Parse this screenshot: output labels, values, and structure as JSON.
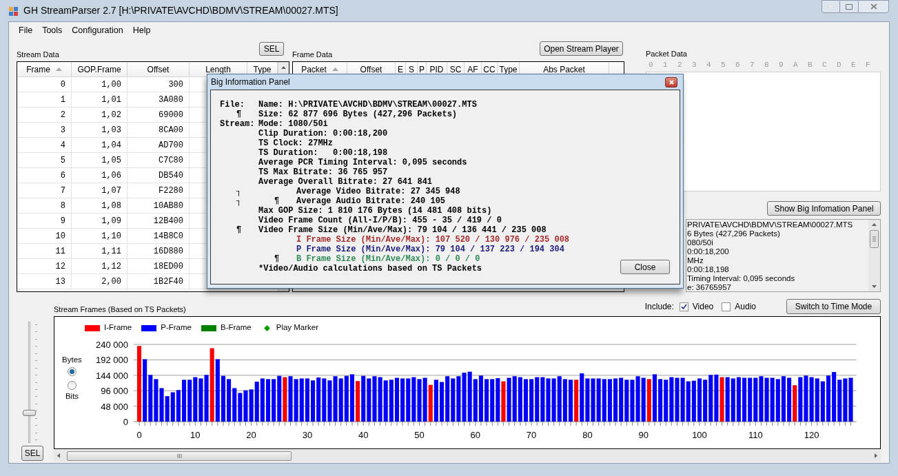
{
  "window": {
    "title": "GH StreamParser 2.7 [H:\\PRIVATE\\AVCHD\\BDMV\\STREAM\\00027.MTS]"
  },
  "menu": [
    "File",
    "Tools",
    "Configuration",
    "Help"
  ],
  "stream_data": {
    "title": "Stream Data",
    "sel_button": "SEL",
    "columns": [
      {
        "label": "Frame",
        "sorted": true
      },
      {
        "label": "GOP.Frame",
        "sorted": false
      },
      {
        "label": "Offset",
        "sorted": false
      },
      {
        "label": "Length",
        "sorted": false
      },
      {
        "label": "Type",
        "sorted": false
      }
    ],
    "rows": [
      [
        "0",
        "1,00",
        "300"
      ],
      [
        "1",
        "1,01",
        "3A080"
      ],
      [
        "2",
        "1,02",
        "69000"
      ],
      [
        "3",
        "1,03",
        "8CA00"
      ],
      [
        "4",
        "1,04",
        "AD700"
      ],
      [
        "5",
        "1,05",
        "C7C80"
      ],
      [
        "6",
        "1,06",
        "DB540"
      ],
      [
        "7",
        "1,07",
        "F2280"
      ],
      [
        "8",
        "1,08",
        "10AB80"
      ],
      [
        "9",
        "1,09",
        "12B400"
      ],
      [
        "10",
        "1,10",
        "14B8C0"
      ],
      [
        "11",
        "1,11",
        "16D880"
      ],
      [
        "12",
        "1,12",
        "18ED00"
      ],
      [
        "13",
        "2,00",
        "1B2F40"
      ]
    ]
  },
  "frame_data": {
    "title": "Frame Data",
    "button": "Open Stream Player",
    "columns": [
      {
        "label": "Packet",
        "sorted": true
      },
      {
        "label": "Offset",
        "sorted": false
      },
      {
        "label": "E",
        "sorted": false
      },
      {
        "label": "S",
        "sorted": false
      },
      {
        "label": "P",
        "sorted": false
      },
      {
        "label": "PID",
        "sorted": false
      },
      {
        "label": "SC",
        "sorted": false
      },
      {
        "label": "AF",
        "sorted": false
      },
      {
        "label": "CC",
        "sorted": false
      },
      {
        "label": "Type",
        "sorted": false
      },
      {
        "label": "Abs Packet",
        "sorted": false
      }
    ]
  },
  "packet_data": {
    "title": "Packet Data",
    "hex_columns": [
      "0",
      "1",
      "2",
      "3",
      "4",
      "5",
      "6",
      "7",
      "8",
      "9",
      "A",
      "B",
      "C",
      "D",
      "E",
      "F"
    ],
    "button": "Show Big Infomation Panel",
    "info_lines": [
      "PRIVATE\\AVCHD\\BDMV\\STREAM\\00027.MTS",
      "6 Bytes (427,296 Packets)",
      "080/50i",
      "0:00:18,200",
      "MHz",
      "0:00:18,198",
      "Timing Interval: 0,095 seconds",
      "e: 36765957"
    ]
  },
  "stream_frames": {
    "title": "Stream Frames (Based on TS Packets)",
    "include_label": "Include:",
    "include": [
      {
        "label": "Video",
        "checked": true
      },
      {
        "label": "Audio",
        "checked": false
      }
    ],
    "button": "Switch to Time Mode",
    "units": [
      {
        "label": "Bytes",
        "selected": true
      },
      {
        "label": "Bits",
        "selected": false
      }
    ],
    "zoom_slider": {
      "level": 0.23
    },
    "sel_button": "SEL",
    "play_marker": {
      "label": "Play Marker",
      "color": "#00a000"
    },
    "chart_data": {
      "type": "bar",
      "stacked": true,
      "grid": true,
      "xlim": [
        -1,
        128
      ],
      "ylim": [
        0,
        240000
      ],
      "x": [
        0,
        1,
        2,
        3,
        4,
        5,
        6,
        7,
        8,
        9,
        10,
        11,
        12,
        13,
        14,
        15,
        16,
        17,
        18,
        19,
        20,
        21,
        22,
        23,
        24,
        25,
        26,
        27,
        28,
        29,
        30,
        31,
        32,
        33,
        34,
        35,
        36,
        37,
        38,
        39,
        40,
        41,
        42,
        43,
        44,
        45,
        46,
        47,
        48,
        49,
        50,
        51,
        52,
        53,
        54,
        55,
        56,
        57,
        58,
        59,
        60,
        61,
        62,
        63,
        64,
        65,
        66,
        67,
        68,
        69,
        70,
        71,
        72,
        73,
        74,
        75,
        76,
        77,
        78,
        79,
        80,
        81,
        82,
        83,
        84,
        85,
        86,
        87,
        88,
        89,
        90,
        91,
        92,
        93,
        94,
        95,
        96,
        97,
        98,
        99,
        100,
        101,
        102,
        103,
        104,
        105,
        106,
        107,
        108,
        109,
        110,
        111,
        112,
        113,
        114,
        115,
        116,
        117,
        118,
        119,
        120,
        121,
        122,
        123,
        124,
        125,
        126,
        127
      ],
      "xticks": [
        0,
        10,
        20,
        30,
        40,
        50,
        60,
        70,
        80,
        90,
        100,
        110,
        120
      ],
      "yticks": [
        {
          "value": 0,
          "label": "0"
        },
        {
          "value": 48000,
          "label": "48 000"
        },
        {
          "value": 96000,
          "label": "96 000"
        },
        {
          "value": 144000,
          "label": "144 000"
        },
        {
          "value": 192000,
          "label": "192 000"
        },
        {
          "value": 240000,
          "label": "240 000"
        }
      ],
      "series": [
        {
          "name": "I-Frame",
          "color": "#ff0000",
          "values": [
            235000,
            null,
            null,
            null,
            null,
            null,
            null,
            null,
            null,
            null,
            null,
            null,
            null,
            228000,
            null,
            null,
            null,
            null,
            null,
            null,
            null,
            null,
            null,
            null,
            null,
            null,
            138000,
            null,
            null,
            null,
            null,
            null,
            null,
            null,
            null,
            null,
            null,
            null,
            null,
            126000,
            null,
            null,
            null,
            null,
            null,
            null,
            null,
            null,
            null,
            null,
            null,
            null,
            114000,
            null,
            null,
            null,
            null,
            null,
            null,
            null,
            null,
            null,
            null,
            null,
            null,
            125000,
            null,
            null,
            null,
            null,
            null,
            null,
            null,
            null,
            null,
            null,
            null,
            null,
            130000,
            null,
            null,
            null,
            null,
            null,
            null,
            null,
            null,
            null,
            null,
            null,
            null,
            132000,
            null,
            null,
            null,
            null,
            null,
            null,
            null,
            null,
            null,
            null,
            null,
            null,
            138000,
            null,
            null,
            null,
            null,
            null,
            null,
            null,
            null,
            null,
            null,
            null,
            null,
            113000,
            null,
            null,
            null,
            null,
            null,
            null,
            null,
            null,
            null,
            null
          ]
        },
        {
          "name": "P-Frame",
          "color": "#0000ff",
          "values": [
            null,
            194000,
            145000,
            132000,
            104000,
            79000,
            91000,
            98000,
            130000,
            130000,
            138000,
            134000,
            145000,
            null,
            194000,
            142000,
            132000,
            104000,
            89000,
            97000,
            100000,
            124000,
            134000,
            132000,
            132000,
            142000,
            null,
            141000,
            132000,
            134000,
            134000,
            128000,
            137000,
            134000,
            128000,
            141000,
            134000,
            142000,
            147000,
            null,
            142000,
            134000,
            141000,
            138000,
            128000,
            130000,
            136000,
            134000,
            134000,
            138000,
            132000,
            136000,
            null,
            130000,
            123000,
            141000,
            134000,
            141000,
            152000,
            155000,
            132000,
            143000,
            132000,
            132000,
            135000,
            null,
            136000,
            141000,
            138000,
            132000,
            132000,
            138000,
            138000,
            134000,
            134000,
            141000,
            132000,
            130000,
            null,
            150000,
            134000,
            134000,
            134000,
            132000,
            132000,
            134000,
            136000,
            130000,
            130000,
            141000,
            136000,
            null,
            147000,
            132000,
            130000,
            138000,
            136000,
            136000,
            125000,
            127000,
            134000,
            130000,
            145000,
            146000,
            null,
            138000,
            134000,
            138000,
            136000,
            136000,
            136000,
            141000,
            136000,
            136000,
            132000,
            141000,
            136000,
            null,
            138000,
            143000,
            138000,
            134000,
            125000,
            143000,
            154000,
            130000,
            134000,
            136000
          ]
        },
        {
          "name": "B-Frame",
          "color": "#008000",
          "values": [
            null,
            null,
            null,
            null,
            null,
            null,
            null,
            null,
            null,
            null,
            null,
            null,
            null,
            null,
            null,
            null,
            null,
            null,
            null,
            null,
            null,
            null,
            null,
            null,
            null,
            null,
            null,
            null,
            null,
            null,
            null,
            null,
            null,
            null,
            null,
            null,
            null,
            null,
            null,
            null,
            null,
            null,
            null,
            null,
            null,
            null,
            null,
            null,
            null,
            null,
            null,
            null,
            null,
            null,
            null,
            null,
            null,
            null,
            null,
            null,
            null,
            null,
            null,
            null,
            null,
            null,
            null,
            null,
            null,
            null,
            null,
            null,
            null,
            null,
            null,
            null,
            null,
            null,
            null,
            null,
            null,
            null,
            null,
            null,
            null,
            null,
            null,
            null,
            null,
            null,
            null,
            null,
            null,
            null,
            null,
            null,
            null,
            null,
            null,
            null,
            null,
            null,
            null,
            null,
            null,
            null,
            null,
            null,
            null,
            null,
            null,
            null,
            null,
            null,
            null,
            null,
            null,
            null,
            null,
            null,
            null,
            null,
            null,
            null,
            null,
            null,
            null,
            null
          ]
        }
      ]
    }
  },
  "dialog": {
    "title": "Big Information Panel",
    "button": "Close",
    "lines": [
      {
        "label": "File:",
        "text": "Name: H:\\PRIVATE\\AVCHD\\BDMV\\STREAM\\00027.MTS"
      },
      {
        "mark": "¶",
        "text": "Size: 62 877 696 Bytes (427,296 Packets)"
      },
      {
        "label": "Stream:",
        "text": "Mode: 1080/50i"
      },
      {
        "text": "Clip Duration: 0:00:18,200"
      },
      {
        "text": "TS Clock: 27MHz"
      },
      {
        "text": "TS Duration:   0:00:18,198"
      },
      {
        "text": "Average PCR Timing Interval: 0,095 seconds"
      },
      {
        "text": "TS Max Bitrate: 36 765 957"
      },
      {
        "text": "Average Overall Bitrate: 27 641 841",
        "children": [
          {
            "mark": "┐",
            "text": "Average Video Bitrate: 27 345 948"
          },
          {
            "mark": "┐",
            "inner_mark": "¶",
            "text": "Average Audio Bitrate: 240 105"
          }
        ]
      },
      {
        "text": "Max GOP Size: 1 810 176 Bytes (14 481 408 bits)"
      },
      {
        "text": "Video Frame Count (All-I/P/B): 455 - 35 / 419 / 0"
      },
      {
        "mark": "¶",
        "text": "Video Frame Size (Min/Ave/Max): 79 104 / 136 441 / 235 008",
        "children": [
          {
            "text": "I Frame Size (Min/Ave/Max): 107 520 / 130 976 / 235 008",
            "color": "#a52a2a"
          },
          {
            "text": "P Frame Size (Min/Ave/Max): 79 104 / 137 223 / 194 304",
            "color": "#1c1c7c"
          },
          {
            "inner_mark": "¶",
            "text": "B Frame Size (Min/Ave/Max): 0 / 0 / 0",
            "color": "#2e8b57"
          }
        ]
      },
      {
        "text": "*Video/Audio calculations based on TS Packets"
      }
    ]
  }
}
